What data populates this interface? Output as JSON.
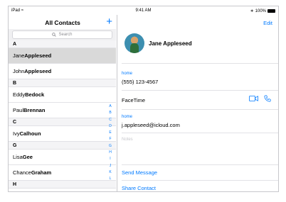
{
  "status": {
    "left": "iPad",
    "time": "9:41 AM",
    "battery": "100%"
  },
  "sidebar": {
    "title": "All Contacts",
    "add_label": "+",
    "search_placeholder": "Search",
    "index_letters": [
      "A",
      "B",
      "C",
      "D",
      "E",
      "F",
      "G",
      "H",
      "I",
      "J",
      "K",
      "L"
    ]
  },
  "contacts": {
    "A": "A",
    "jane_first": "Jane ",
    "jane_last": "Appleseed",
    "john_first": "John ",
    "john_last": "Appleseed",
    "B": "B",
    "eddy_first": "Eddy ",
    "eddy_last": "Bedock",
    "paul_first": "Paul ",
    "paul_last": "Brennan",
    "C": "C",
    "ivy_first": "Ivy ",
    "ivy_last": "Calhoun",
    "G": "G",
    "lisa_first": "Lisa ",
    "lisa_last": "Gee",
    "chance_first": "Chance ",
    "chance_last": "Graham",
    "H": "H"
  },
  "detail": {
    "edit_label": "Edit",
    "name": "Jane Appleseed",
    "phone_label": "home",
    "phone": "(555) 123-4567",
    "facetime_label": "FaceTime",
    "email_label": "home",
    "email": "j.appleseed@icloud.com",
    "notes_placeholder": "Notes",
    "send_message": "Send Message",
    "share_contact": "Share Contact"
  },
  "colors": {
    "accent": "#007aff",
    "selected_row": "#d9d9d9"
  }
}
